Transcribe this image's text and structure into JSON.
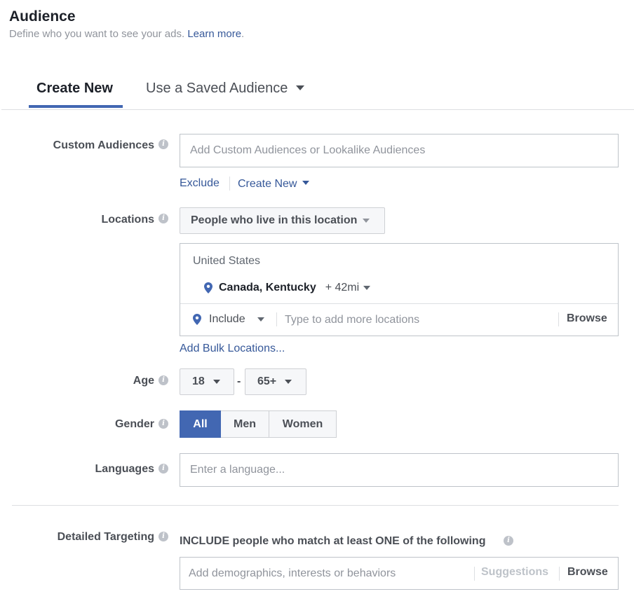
{
  "header": {
    "title": "Audience",
    "subtitle": "Define who you want to see your ads.",
    "learn_more": "Learn more",
    "subtitle_end": "."
  },
  "tabs": {
    "create_new": "Create New",
    "saved": "Use a Saved Audience"
  },
  "custom_audiences": {
    "label": "Custom Audiences",
    "placeholder": "Add Custom Audiences or Lookalike Audiences",
    "exclude": "Exclude",
    "create_new": "Create New"
  },
  "locations": {
    "label": "Locations",
    "dropdown": "People who live in this location",
    "country": "United States",
    "location_name": "Canada, Kentucky",
    "radius": "+ 42mi",
    "include": "Include",
    "placeholder": "Type to add more locations",
    "browse": "Browse",
    "bulk": "Add Bulk Locations..."
  },
  "age": {
    "label": "Age",
    "min": "18",
    "separator": "-",
    "max": "65+"
  },
  "gender": {
    "label": "Gender",
    "options": [
      "All",
      "Men",
      "Women"
    ],
    "selected": "All"
  },
  "languages": {
    "label": "Languages",
    "placeholder": "Enter a language..."
  },
  "detailed_targeting": {
    "label": "Detailed Targeting",
    "include_text": "INCLUDE people who match at least ONE of the following",
    "placeholder": "Add demographics, interests or behaviors",
    "suggestions": "Suggestions",
    "browse": "Browse"
  },
  "colors": {
    "accent": "#4267b2",
    "link": "#365899",
    "pin": "#4267b2"
  }
}
